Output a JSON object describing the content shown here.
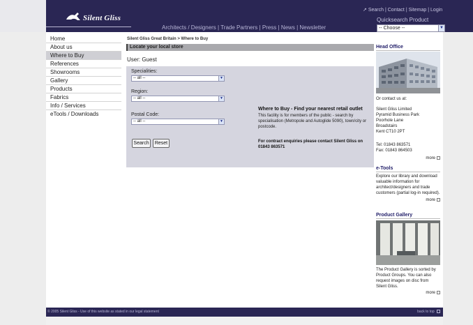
{
  "header": {
    "logo_text": "Silent Gliss",
    "utility_nav": {
      "search": "Search",
      "contact": "Contact",
      "sitemap": "Sitemap",
      "login": "Login",
      "separator": "|"
    },
    "main_nav": {
      "items": [
        "Architects / Designers",
        "Trade Partners",
        "Press",
        "News",
        "Newsletter"
      ],
      "separator": "|"
    },
    "quicksearch": {
      "label": "Quicksearch Product",
      "selected": "-- Choose --"
    }
  },
  "sidebar": {
    "items": [
      {
        "label": "Home"
      },
      {
        "label": "About us"
      },
      {
        "label": "Where to Buy"
      },
      {
        "label": "References"
      },
      {
        "label": "Showrooms"
      },
      {
        "label": "Gallery"
      },
      {
        "label": "Products"
      },
      {
        "label": "Fabrics"
      },
      {
        "label": "Info / Services"
      },
      {
        "label": "eTools / Downloads"
      }
    ]
  },
  "main": {
    "breadcrumb": "Silent Gliss Great Britain  >  Where to Buy",
    "panel_title": "Locate your local store",
    "user_line": "User:  Guest",
    "form": {
      "specialities_label": "Specialities:",
      "specialities_value": "-- all --",
      "region_label": "Region:",
      "region_value": "-- all --",
      "postal_label": "Postal Code:",
      "postal_value": "-- all --",
      "search_button": "Search",
      "reset_button": "Reset"
    },
    "info": {
      "title": "Where to Buy - Find your nearest retail outlet",
      "body": "This facility is for members of the public - search by specialisation (Metropole and Autoglide 5090), town/city or postcode.",
      "contact": "For contract enquiries please contact Silent Gliss on 01843 863571"
    }
  },
  "right_column": {
    "head_office": {
      "title": "Head Office",
      "contact_intro": "Or contact us at:",
      "address": [
        "Silent Gliss Limited",
        "Pyramid Business Park",
        "Poorhole Lane",
        "Broadstairs",
        "Kent CT10 2PT"
      ],
      "tel": "Tel: 01843 863571",
      "fax": "Fax: 01843 864503",
      "more": "more"
    },
    "etools": {
      "title": "e-Tools",
      "text": "Explore our library and download valuable information for architect/designers and trade customers (partial log-in required).",
      "more": "more"
    },
    "gallery": {
      "title": "Product Gallery",
      "text": "The Product Gallery is sorted by Product Groups. You can also request images on disc from Silent Gliss.",
      "more": "more"
    }
  },
  "footer": {
    "left": "© 2005 Silent Gliss - Use of this website as stated in our legal statement",
    "right": "back to top"
  },
  "colors": {
    "header_bg": "#2a2654",
    "panel_bg": "#d5d5df",
    "accent_heading": "#23206a"
  }
}
